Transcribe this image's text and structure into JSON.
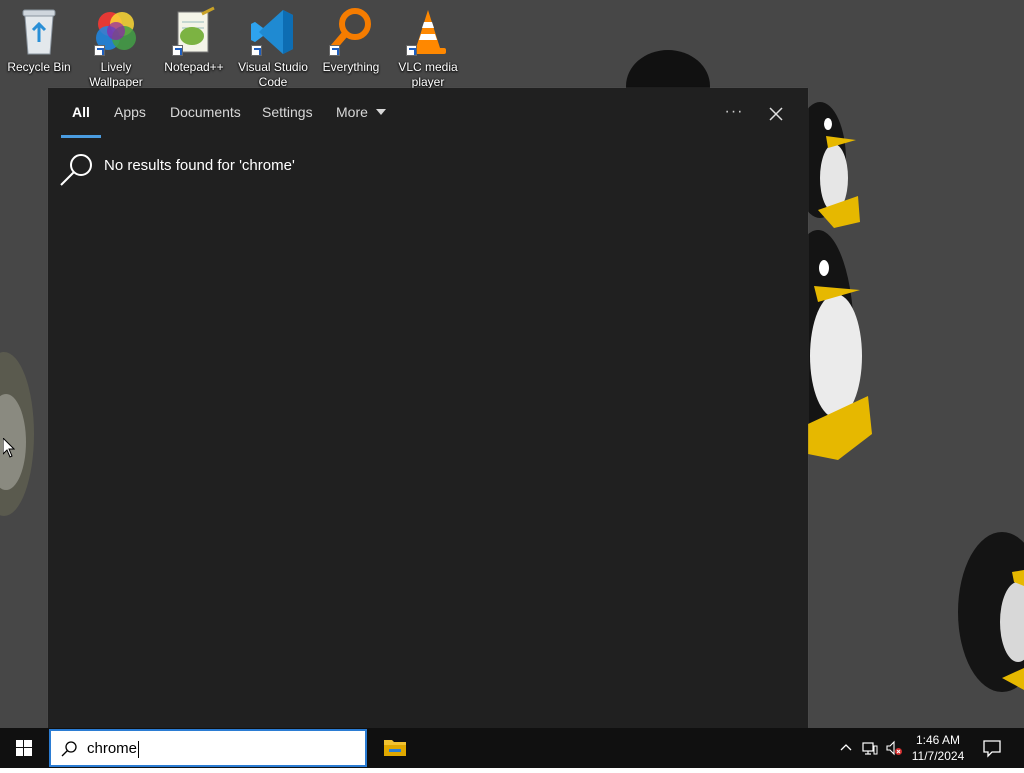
{
  "desktop": {
    "icons": [
      {
        "label": "Recycle Bin",
        "icon": "recycle-bin-icon"
      },
      {
        "label": "Lively Wallpaper",
        "icon": "lively-wallpaper-icon"
      },
      {
        "label": "Notepad++",
        "icon": "notepadpp-icon"
      },
      {
        "label": "Visual Studio Code",
        "icon": "vscode-icon"
      },
      {
        "label": "Everything",
        "icon": "everything-search-icon"
      },
      {
        "label": "VLC media player",
        "icon": "vlc-icon"
      }
    ]
  },
  "search_panel": {
    "tabs": [
      {
        "label": "All",
        "active": true
      },
      {
        "label": "Apps",
        "active": false
      },
      {
        "label": "Documents",
        "active": false
      },
      {
        "label": "Settings",
        "active": false
      },
      {
        "label": "More",
        "active": false
      }
    ],
    "options_label": "···",
    "no_results_text": "No results found for 'chrome'"
  },
  "taskbar": {
    "search_value": "chrome",
    "time": "1:46 AM",
    "date": "11/7/2024"
  },
  "colors": {
    "accent": "#4a9ce0",
    "panel_bg": "#202020",
    "taskbar_bg": "#101010",
    "desktop_bg": "#474747"
  }
}
